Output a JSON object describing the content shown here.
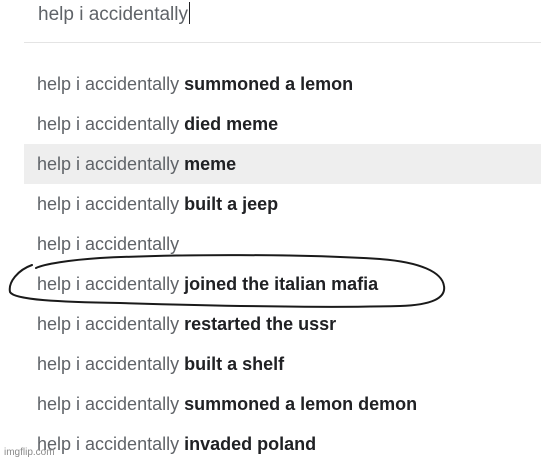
{
  "search": {
    "query": "help i accidentally"
  },
  "suggestions": [
    {
      "prefix": "help i accidentally",
      "completion": "summoned a lemon",
      "highlighted": false
    },
    {
      "prefix": "help i accidentally",
      "completion": "died meme",
      "highlighted": false
    },
    {
      "prefix": "help i accidentally",
      "completion": "meme",
      "highlighted": true
    },
    {
      "prefix": "help i accidentally",
      "completion": "built a jeep",
      "highlighted": false
    },
    {
      "prefix": "help i accidentally",
      "completion": "",
      "highlighted": false
    },
    {
      "prefix": "help i accidentally",
      "completion": "joined the italian mafia",
      "highlighted": false,
      "circled": true
    },
    {
      "prefix": "help i accidentally",
      "completion": "restarted the ussr",
      "highlighted": false
    },
    {
      "prefix": "help i accidentally",
      "completion": "built a shelf",
      "highlighted": false
    },
    {
      "prefix": "help i accidentally",
      "completion": "summoned a lemon demon",
      "highlighted": false
    },
    {
      "prefix": "help i accidentally",
      "completion": "invaded poland",
      "highlighted": false
    }
  ],
  "watermark": "imgflip.com",
  "colors": {
    "highlight_bg": "#eeeeee",
    "prefix_text": "#5f6368",
    "completion_text": "#202124",
    "circle_stroke": "#1a1a1a"
  }
}
